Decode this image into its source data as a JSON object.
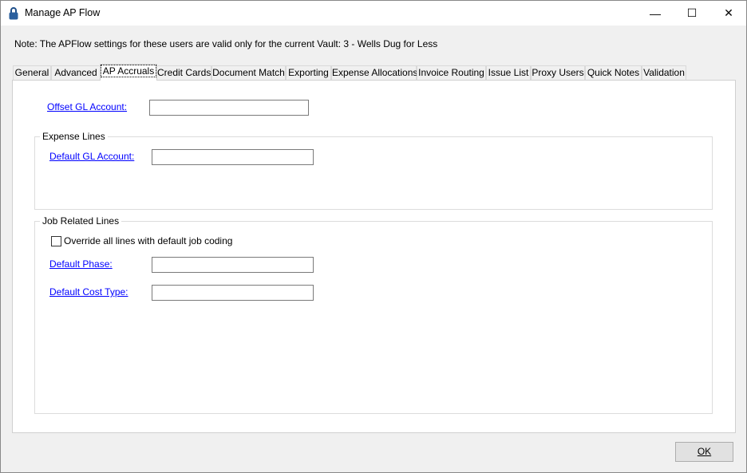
{
  "window": {
    "title": "Manage AP Flow",
    "icon": "lock-icon"
  },
  "note": "Note:  The APFlow settings for these users are valid only for the current Vault: 3 - Wells Dug for Less",
  "tabs": [
    {
      "label": "General"
    },
    {
      "label": "Advanced"
    },
    {
      "label": "AP Accruals",
      "active": true
    },
    {
      "label": "Credit Cards"
    },
    {
      "label": "Document Match"
    },
    {
      "label": "Exporting"
    },
    {
      "label": "Expense Allocations"
    },
    {
      "label": "Invoice Routing"
    },
    {
      "label": "Issue List"
    },
    {
      "label": "Proxy Users"
    },
    {
      "label": "Quick Notes"
    },
    {
      "label": "Validation"
    }
  ],
  "offset_gl": {
    "label": "Offset GL Account:",
    "value": ""
  },
  "expense_lines": {
    "title": "Expense Lines",
    "default_gl": {
      "label": "Default GL Account:",
      "value": ""
    }
  },
  "job_lines": {
    "title": "Job Related Lines",
    "override": {
      "label": "Override all lines with default job coding",
      "checked": false
    },
    "default_phase": {
      "label": "Default Phase:",
      "value": ""
    },
    "default_cost_type": {
      "label": "Default Cost Type:",
      "value": ""
    }
  },
  "ok_label": "OK"
}
